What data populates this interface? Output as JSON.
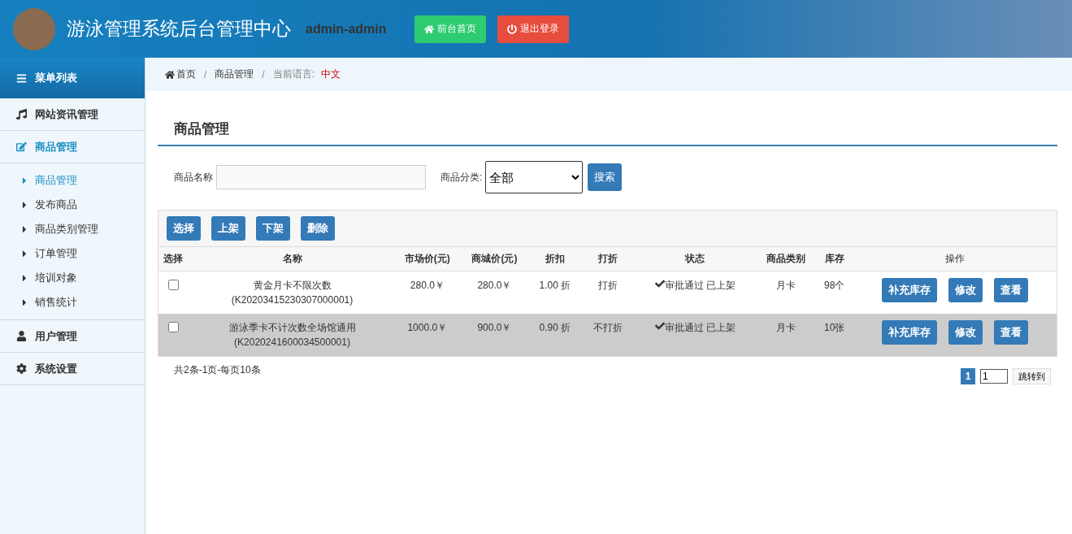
{
  "header": {
    "title": "游泳管理系统后台管理中心",
    "user": "admin-admin",
    "buttons": [
      {
        "label": "前台首页",
        "kind": "home"
      },
      {
        "label": "退出登录",
        "kind": "logout"
      }
    ]
  },
  "sidebar": {
    "heading": "菜单列表",
    "groups": [
      {
        "label": "网站资讯管理",
        "expanded": false
      },
      {
        "label": "商品管理",
        "expanded": true,
        "children": [
          {
            "label": "商品管理",
            "selected": true
          },
          {
            "label": "发布商品",
            "selected": false
          },
          {
            "label": "商品类别管理",
            "selected": false
          },
          {
            "label": "订单管理",
            "selected": false
          },
          {
            "label": "培训对象",
            "selected": false
          },
          {
            "label": "销售统计",
            "selected": false
          }
        ]
      },
      {
        "label": "用户管理",
        "expanded": false
      },
      {
        "label": "系统设置",
        "expanded": false
      }
    ]
  },
  "breadcrumb": {
    "items": [
      "首页",
      "商品管理"
    ],
    "separator": "/",
    "language_label": "当前语言:",
    "language": "中文"
  },
  "page_title": "商品管理",
  "filters": {
    "name_label": "商品名称",
    "category_label": "商品分类:",
    "category_value": "全部",
    "search_button": "搜索"
  },
  "actions": [
    "选择",
    "上架",
    "下架",
    "删除"
  ],
  "table": {
    "columns": [
      "选择",
      "名称",
      "市场价(元)",
      "商城价(元)",
      "折扣",
      "打折",
      "状态",
      "商品类别",
      "库存",
      "操作"
    ],
    "rows": [
      {
        "checked": false,
        "name": "黄金月卡不限次数(K20203415230307000001)",
        "market_price": "280.0￥",
        "mall_price": "280.0￥",
        "discount": "1.00 折",
        "discounted": "打折",
        "status": "审批通过 已上架",
        "category": "月卡",
        "stock": "98个",
        "buttons": [
          "补充库存",
          "修改",
          "查看"
        ]
      },
      {
        "checked": false,
        "name": "游泳季卡不计次数全场馆通用(K2020241600034500001)",
        "market_price": "1000.0￥",
        "mall_price": "900.0￥",
        "discount": "0.90 折",
        "discounted": "不打折",
        "status": "审批通过 已上架",
        "category": "月卡",
        "stock": "10张",
        "buttons": [
          "补充库存",
          "修改",
          "查看"
        ]
      }
    ]
  },
  "pagination": {
    "summary": "共2条-1页-每页10条",
    "pages": [
      {
        "label": "1",
        "selected": true
      }
    ],
    "jump_value": "1",
    "jump_button": "跳转到"
  }
}
